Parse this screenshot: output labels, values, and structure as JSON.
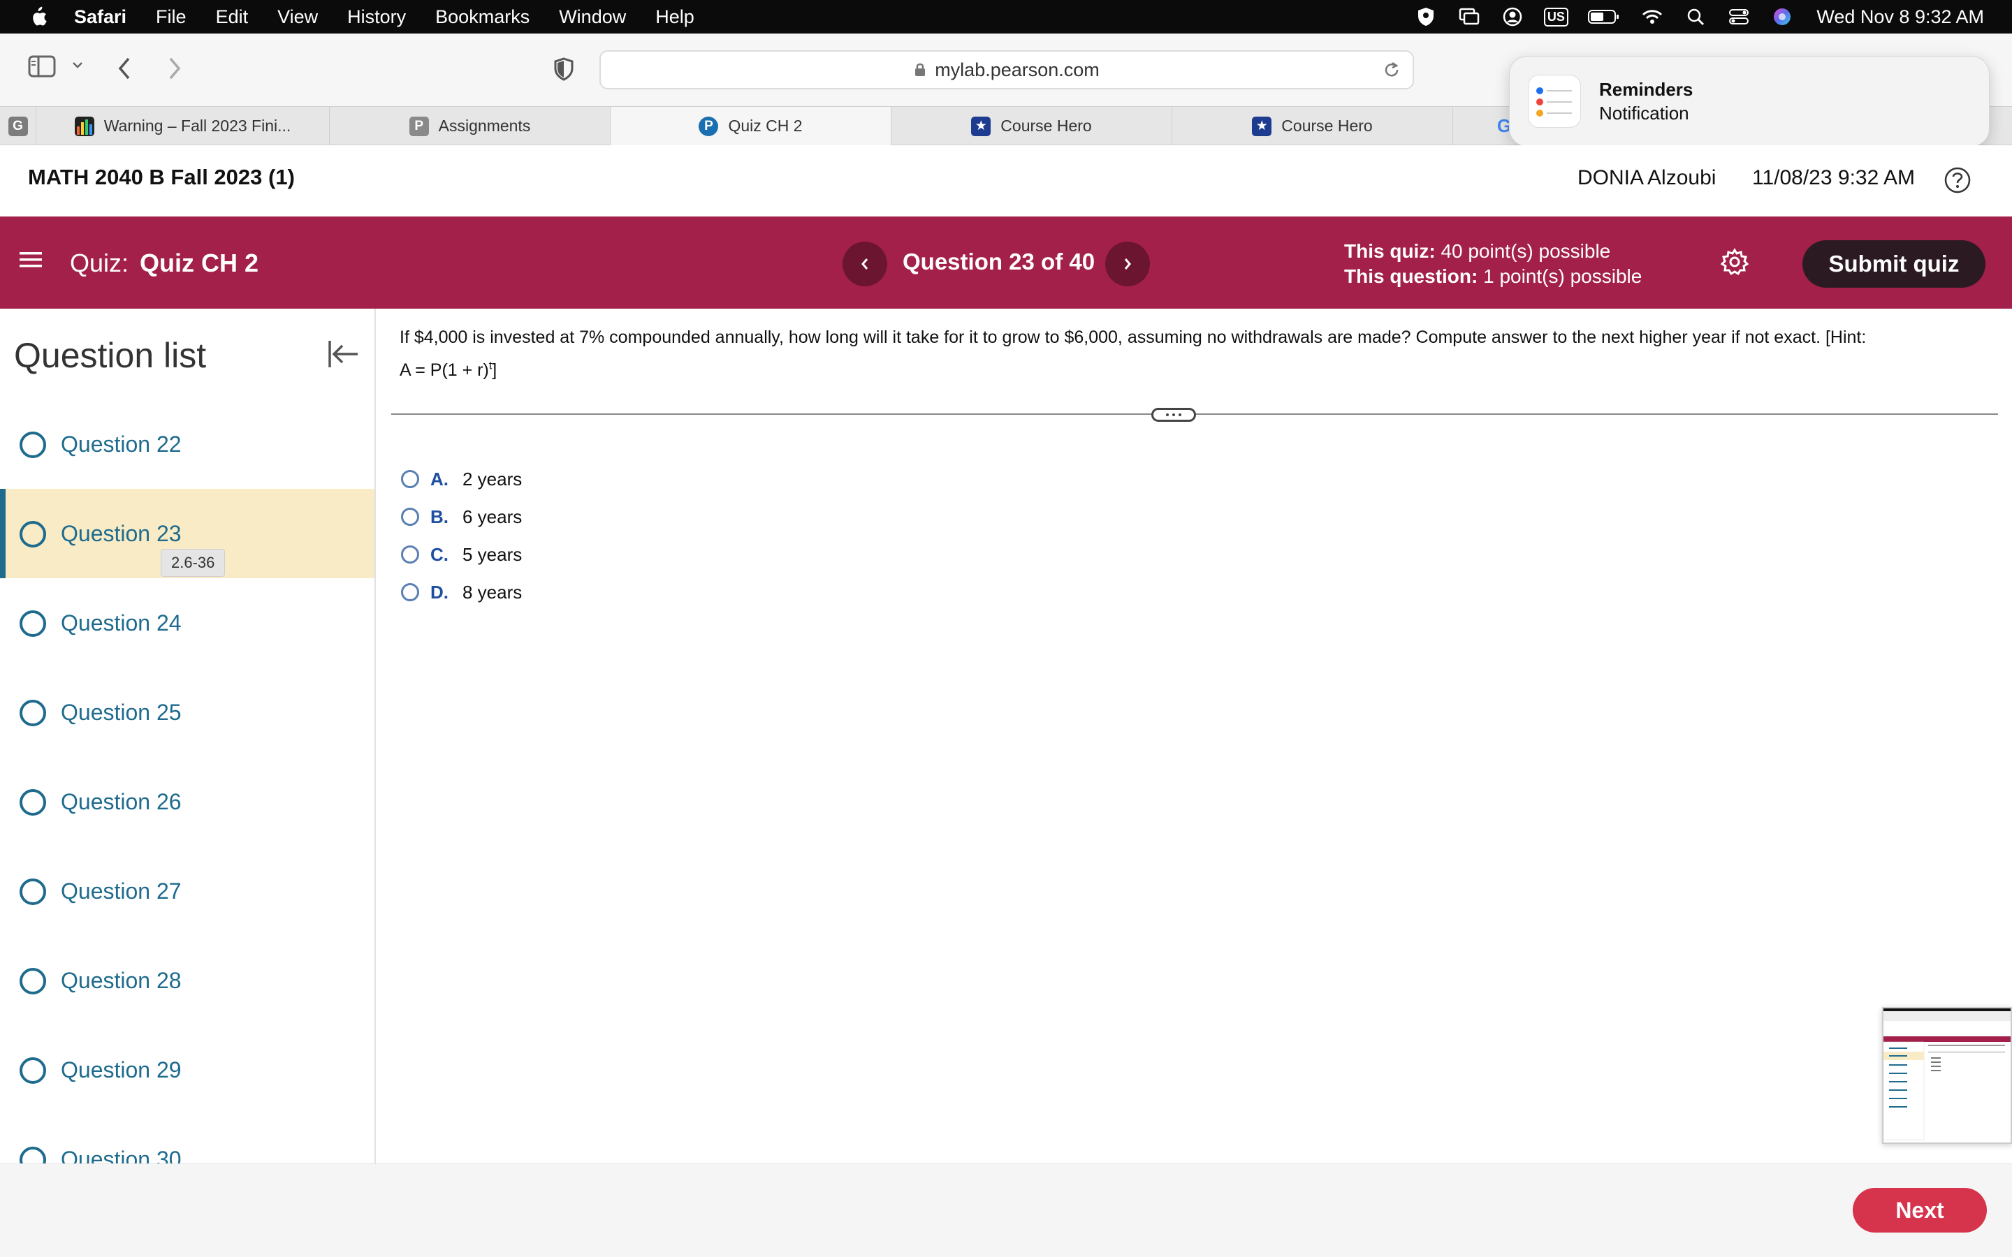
{
  "menubar": {
    "app": "Safari",
    "items": [
      "File",
      "Edit",
      "View",
      "History",
      "Bookmarks",
      "Window",
      "Help"
    ],
    "keyboard": "US",
    "clock": "Wed Nov 8  9:32 AM"
  },
  "browser": {
    "url": "mylab.pearson.com",
    "tabs": [
      {
        "label": "",
        "icon": "G"
      },
      {
        "label": "Warning – Fall 2023 Fini...",
        "icon": "chart-icon"
      },
      {
        "label": "Assignments",
        "icon": "P"
      },
      {
        "label": "Quiz CH 2",
        "icon": "P"
      },
      {
        "label": "Course Hero",
        "icon": "star-icon"
      },
      {
        "label": "Course Hero",
        "icon": "star-icon"
      },
      {
        "label": "",
        "icon": "G"
      }
    ]
  },
  "notification": {
    "title": "Reminders",
    "body": "Notification"
  },
  "course": {
    "title": "MATH 2040 B Fall 2023 (1)",
    "user": "DONIA Alzoubi",
    "datetime": "11/08/23 9:32 AM"
  },
  "quizbar": {
    "label": "Quiz:",
    "name": "Quiz CH 2",
    "counter": "Question 23 of 40",
    "quiz_points_label": "This quiz:",
    "quiz_points": "40 point(s) possible",
    "question_points_label": "This question:",
    "question_points": "1 point(s) possible",
    "submit_label": "Submit quiz"
  },
  "sidebar": {
    "title": "Question list",
    "items": [
      {
        "label": "Question 22"
      },
      {
        "label": "Question 23",
        "tag": "2.6-36"
      },
      {
        "label": "Question 24"
      },
      {
        "label": "Question 25"
      },
      {
        "label": "Question 26"
      },
      {
        "label": "Question 27"
      },
      {
        "label": "Question 28"
      },
      {
        "label": "Question 29"
      },
      {
        "label": "Question 30"
      }
    ]
  },
  "question": {
    "text": "If $4,000 is invested at 7% compounded annually, how long will it take for it to grow to $6,000, assuming no withdrawals are made? Compute answer to the next higher year if not exact. [Hint:",
    "hint_formula": "A = P(1 + r)",
    "hint_exponent": "t",
    "hint_close": "]",
    "options": [
      {
        "letter": "A.",
        "text": "2 years"
      },
      {
        "letter": "B.",
        "text": "6 years"
      },
      {
        "letter": "C.",
        "text": "5 years"
      },
      {
        "letter": "D.",
        "text": "8 years"
      }
    ]
  },
  "footer": {
    "next_label": "Next"
  },
  "colors": {
    "quizbar": "#a3204a",
    "link": "#1e6b8e",
    "current_row": "#f8ebc6",
    "next_button": "#d6334c"
  }
}
